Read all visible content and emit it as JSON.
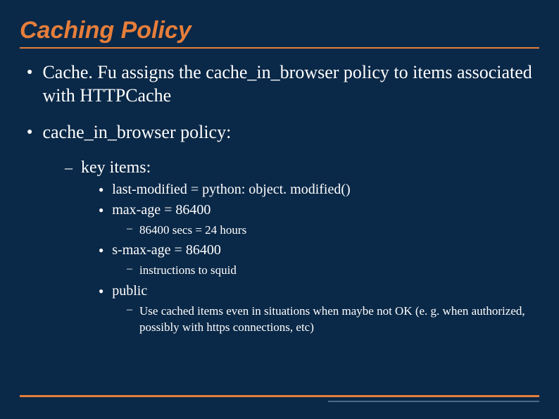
{
  "title": "Caching Policy",
  "bullets": {
    "b1": "Cache. Fu assigns the cache_in_browser policy to items associated with HTTPCache",
    "b2": "cache_in_browser policy:",
    "b2_1": "key items:",
    "b2_1_a": "last-modified = python: object. modified()",
    "b2_1_b": "max-age = 86400",
    "b2_1_b_i": "86400 secs = 24 hours",
    "b2_1_c": "s-max-age = 86400",
    "b2_1_c_i": "instructions to squid",
    "b2_1_d": "public",
    "b2_1_d_i": "Use cached items even in situations when maybe not OK (e. g. when authorized, possibly with https connections, etc)"
  },
  "glyphs": {
    "dot": "●",
    "dash": "–"
  }
}
